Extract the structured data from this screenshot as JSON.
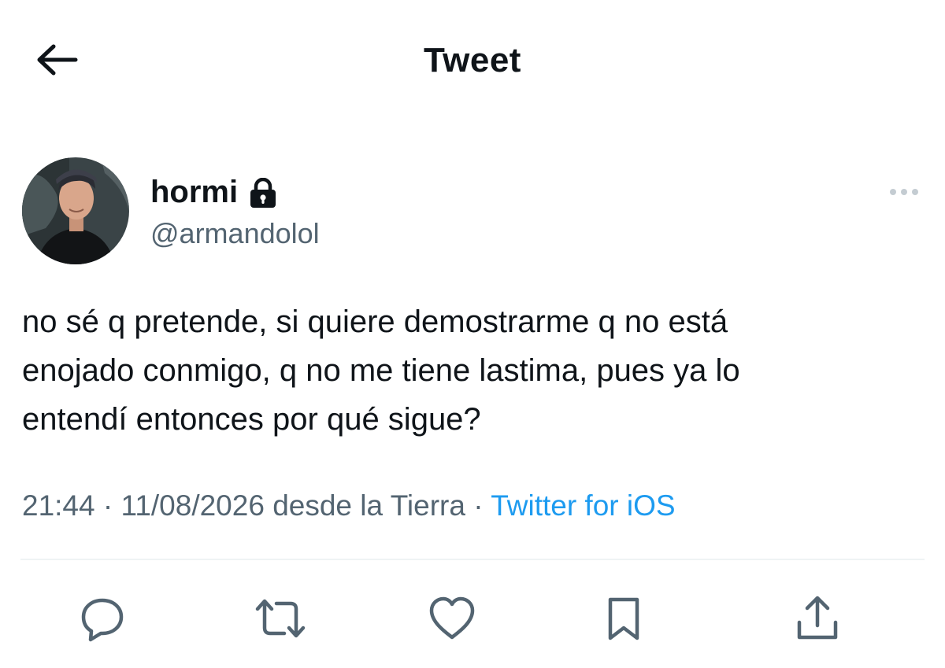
{
  "header": {
    "title": "Tweet",
    "back_icon": "arrow-left-icon"
  },
  "author": {
    "display_name": "hormi",
    "handle": "@armandolol",
    "protected_icon": "lock-icon",
    "avatar": "avatar-photo"
  },
  "more_icon": "more-horizontal-icon",
  "tweet": {
    "text": "no sé q pretende, si quiere demostrarme q no está\nenojado conmigo, q no me tiene lastima, pues ya lo\nentendí entonces por qué sigue?",
    "time": "21:44",
    "separator": "·",
    "date": "11/08/2026",
    "location": "desde la Tierra",
    "source": "Twitter for iOS"
  },
  "actions": [
    {
      "icon": "reply-icon"
    },
    {
      "icon": "retweet-icon"
    },
    {
      "icon": "like-icon"
    },
    {
      "icon": "bookmark-icon"
    },
    {
      "icon": "share-icon"
    }
  ],
  "colors": {
    "text": "#0f1419",
    "secondary": "#536471",
    "accent": "#1d9bf0",
    "divider": "#eff3f4"
  }
}
